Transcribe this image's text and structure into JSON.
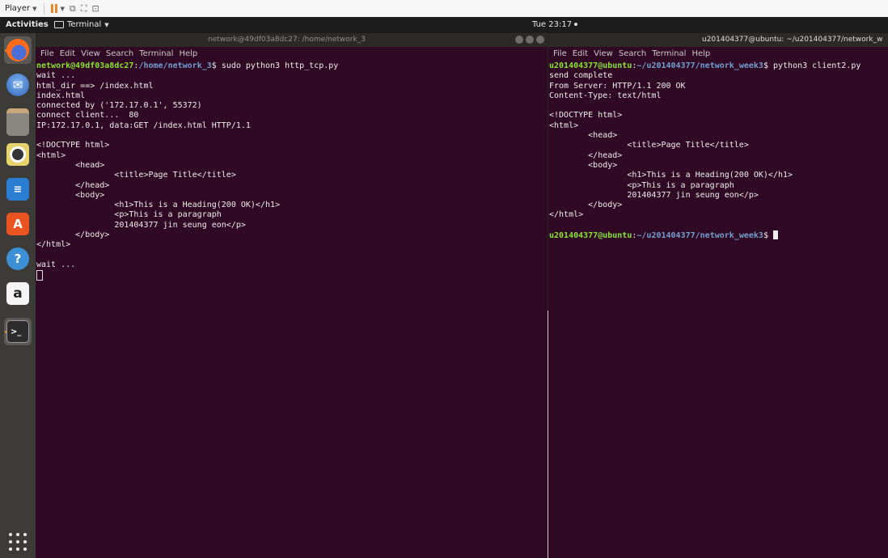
{
  "player_bar": {
    "menu_label": "Player"
  },
  "top_bar": {
    "activities": "Activities",
    "app_menu": "Terminal",
    "clock": "Tue 23:17"
  },
  "dock": {
    "items": [
      "firefox-icon",
      "thunderbird-icon",
      "files-icon",
      "rhythmbox-icon",
      "writer-icon",
      "software-icon",
      "help-icon",
      "amazon-icon",
      "terminal-icon"
    ]
  },
  "left_terminal": {
    "title": "network@49df03a8dc27: /home/network_3",
    "menu": [
      "File",
      "Edit",
      "View",
      "Search",
      "Terminal",
      "Help"
    ],
    "prompt_user": "network@49df03a8dc27",
    "prompt_sep": ":",
    "prompt_path": "/home/network_3",
    "prompt_end": "$ ",
    "command": "sudo python3 http_tcp.py",
    "lines": [
      "wait ...",
      "html_dir ==> /index.html",
      "index.html",
      "connected by ('172.17.0.1', 55372)",
      "connect client...  80",
      "IP:172.17.0.1, data:GET /index.html HTTP/1.1",
      "",
      "<!DOCTYPE html>",
      "<html>",
      "        <head>",
      "                <title>Page Title</title>",
      "        </head>",
      "        <body>",
      "                <h1>This is a Heading(200 OK)</h1>",
      "                <p>This is a paragraph",
      "                201404377 jin seung eon</p>",
      "        </body>",
      "</html>",
      "",
      "wait ..."
    ]
  },
  "right_terminal": {
    "title": "u201404377@ubuntu: ~/u201404377/network_w",
    "menu": [
      "File",
      "Edit",
      "View",
      "Search",
      "Terminal",
      "Help"
    ],
    "prompt_user": "u201404377@ubuntu",
    "prompt_sep": ":",
    "prompt_path": "~/u201404377/network_week3",
    "prompt_end": "$ ",
    "command": "python3 client2.py",
    "lines": [
      "send complete",
      "From Server: HTTP/1.1 200 OK",
      "Content-Type: text/html",
      "",
      "<!DOCTYPE html>",
      "<html>",
      "        <head>",
      "                <title>Page Title</title>",
      "        </head>",
      "        <body>",
      "                <h1>This is a Heading(200 OK)</h1>",
      "                <p>This is a paragraph",
      "                201404377 jin seung eon</p>",
      "        </body>",
      "</html>",
      ""
    ]
  }
}
